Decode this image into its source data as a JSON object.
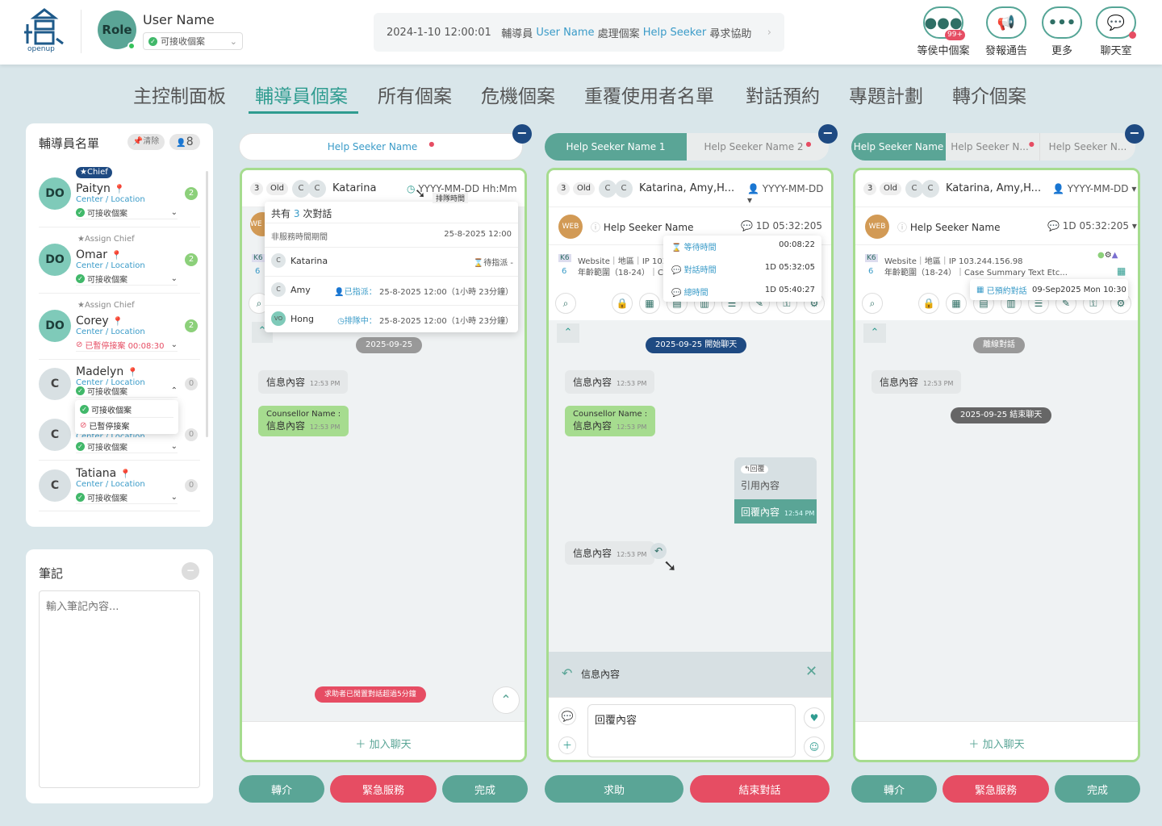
{
  "header": {
    "logo_text": "openup",
    "role": "Role",
    "user_name": "User Name",
    "user_status": "可接收個案",
    "notice": {
      "time": "2024-1-10 12:00:01",
      "p1": "輔導員",
      "user": "User Name",
      "p2": "處理個案",
      "seeker": "Help Seeker",
      "p3": "尋求協助"
    },
    "buttons": [
      {
        "label": "等侯中個案",
        "badge": "99+",
        "icon": "users-icon"
      },
      {
        "label": "發報通告",
        "icon": "megaphone-icon"
      },
      {
        "label": "更多",
        "icon": "more-icon"
      },
      {
        "label": "聊天室",
        "icon": "chat-icon"
      }
    ]
  },
  "nav": [
    "主控制面板",
    "輔導員個案",
    "所有個案",
    "危機個案",
    "重覆使用者名單",
    "對話預約",
    "專題計劃",
    "轉介個案"
  ],
  "sidebar": {
    "title": "輔導員名單",
    "clear": "清除",
    "count": "8",
    "counsellors": [
      {
        "initials": "DO",
        "tag": "Chief",
        "name": "Paityn",
        "loc": "Center / Location",
        "status": "可接收個案",
        "count": "2"
      },
      {
        "initials": "DO",
        "tag": "Assign Chief",
        "name": "Omar",
        "loc": "Center / Location",
        "status": "可接收個案",
        "count": "2"
      },
      {
        "initials": "DO",
        "tag": "Assign Chief",
        "name": "Corey",
        "loc": "Center / Location",
        "status": "已暫停接案 00:08:30",
        "count": "2"
      },
      {
        "initials": "C",
        "name": "Madelyn",
        "loc": "Center / Location",
        "status": "可接收個案",
        "count": "0"
      },
      {
        "initials": "C",
        "name": "",
        "loc": "Center / Location",
        "status": "可接收個案",
        "count": "0"
      },
      {
        "initials": "C",
        "name": "Tatiana",
        "loc": "Center / Location",
        "status": "可接收個案",
        "count": "0"
      }
    ],
    "dropdown": [
      "可接收個案",
      "已暫停接案"
    ]
  },
  "notes": {
    "title": "筆記",
    "placeholder": "輸入筆記內容..."
  },
  "panel1": {
    "tab": "Help Seeker Name",
    "count": "3",
    "old": "Old",
    "cc": "C",
    "name": "Katarina",
    "time": "YYYY-MM-DD Hh:Mm",
    "tooltip": "排隊時間",
    "popup": {
      "total_pre": "共有",
      "total_num": "3",
      "total_post": "次對話",
      "nonservice": "非服務時間期間",
      "nonservice_date": "25-8-2025 12:00",
      "rows": [
        {
          "i": "C",
          "name": "Katarina",
          "status": "待指派",
          "detail": "-"
        },
        {
          "i": "C",
          "name": "Amy",
          "status": "已指派：",
          "detail": "25-8-2025 12:00（1小時 23分鐘）"
        },
        {
          "i": "VO",
          "name": "Hong",
          "status": "排隊中：",
          "detail": "25-8-2025 12:00（1小時 23分鐘）"
        }
      ]
    },
    "date": "2025-09-25",
    "msg_in": "信息內容",
    "msg_in_time": "12:53 PM",
    "msg_out_name": "Counsellor Name :",
    "msg_out": "信息內容",
    "msg_out_time": "12:53 PM",
    "idle_warning": "求助者已閒置對話超過5分鐘",
    "join": "加入聊天",
    "actions": [
      "轉介",
      "緊急服務",
      "完成"
    ],
    "web": "WE",
    "k6": "K6",
    "k6n": "6"
  },
  "panel2": {
    "tabs": [
      "Help Seeker Name 1",
      "Help Seeker Name 2"
    ],
    "count": "3",
    "old": "Old",
    "cc": "C",
    "name": "Katarina, Amy,H...",
    "date": "YYYY-MM-DD",
    "web": "WEB",
    "seeker": "Help Seeker Name",
    "duration": "1D 05:32:205",
    "info1": "Website｜地區｜IP 103.",
    "info2": "年齡範圍（18-24）｜Cas",
    "k6": "K6",
    "k6n": "6",
    "popup": [
      {
        "label": "等待時間",
        "value": "00:08:22"
      },
      {
        "label": "對話時間",
        "value": "1D 05:32:05"
      },
      {
        "label": "總時間",
        "value": "1D 05:40:27"
      }
    ],
    "start": "2025-09-25 開始聊天",
    "msg_in": "信息內容",
    "msg_in_time": "12:53 PM",
    "msg_out_name": "Counsellor Name :",
    "msg_out": "信息內容",
    "msg_out_time": "12:53 PM",
    "reply_tag": "回覆",
    "quote": "引用內容",
    "reply": "回覆內容",
    "reply_time": "12:54 PM",
    "msg_in2": "信息內容",
    "msg_in2_time": "12:53 PM",
    "replying_to": "信息內容",
    "input_value": "回覆內容",
    "actions": [
      "求助",
      "結束對話"
    ]
  },
  "panel3": {
    "tabs": [
      "Help Seeker Name",
      "Help Seeker N...",
      "Help Seeker N..."
    ],
    "count": "3",
    "old": "Old",
    "cc": "C",
    "name": "Katarina, Amy,H...",
    "date": "YYYY-MM-DD",
    "web": "WEB",
    "seeker": "Help Seeker Name",
    "duration": "1D 05:32:205",
    "info1": "Website｜地區｜IP 103.244.156.98",
    "info2": "年齡範圍（18-24）｜Case Summary Text Etc...",
    "k6": "K6",
    "k6n": "6",
    "booked": "已預約對話",
    "booked_time": "09-Sep2025 Mon 10:30",
    "offline": "離線對話",
    "msg_in": "信息內容",
    "msg_in_time": "12:53 PM",
    "end": "2025-09-25 結束聊天",
    "join": "加入聊天",
    "actions": [
      "轉介",
      "緊急服務",
      "完成"
    ]
  },
  "colors": {
    "teal": "#5aa596",
    "red": "#e64d63",
    "navy": "#1e4a82",
    "green_border": "#a6dc8f",
    "link": "#3a9bc8"
  }
}
